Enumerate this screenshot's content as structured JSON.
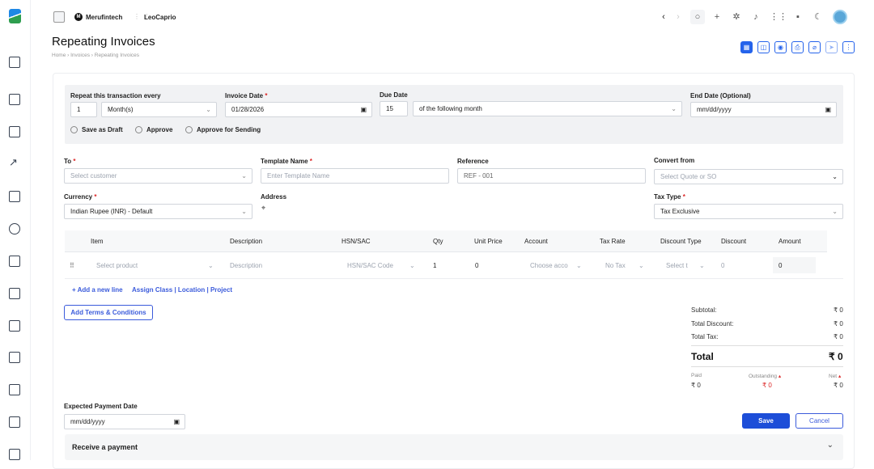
{
  "topbar": {
    "org": "Merufintech",
    "org_initial": "M",
    "user": "LeoCaprio"
  },
  "page": {
    "title": "Repeating Invoices",
    "breadcrumb": [
      "Home",
      "Invoices",
      "Repeating Invoices"
    ]
  },
  "repeat": {
    "label": "Repeat this transaction every",
    "count": "1",
    "unit": "Month(s)"
  },
  "invoice_date": {
    "label": "Invoice Date",
    "value": "01/28/2026"
  },
  "due_date": {
    "label": "Due Date",
    "days": "15",
    "term": "of the following month"
  },
  "end_date": {
    "label": "End Date (Optional)",
    "placeholder": "mm/dd/yyyy"
  },
  "status_options": [
    "Save as Draft",
    "Approve",
    "Approve for Sending"
  ],
  "to": {
    "label": "To",
    "placeholder": "Select customer"
  },
  "template": {
    "label": "Template Name",
    "placeholder": "Enter Template Name"
  },
  "reference": {
    "label": "Reference",
    "value": "REF - 001"
  },
  "convert": {
    "label": "Convert from",
    "placeholder": "Select Quote or SO"
  },
  "currency": {
    "label": "Currency",
    "value": "Indian Rupee (INR) - Default"
  },
  "address": {
    "label": "Address"
  },
  "tax_type": {
    "label": "Tax Type",
    "value": "Tax Exclusive"
  },
  "table": {
    "headers": [
      "Item",
      "Description",
      "HSN/SAC",
      "Qty",
      "Unit Price",
      "Account",
      "Tax Rate",
      "Discount Type",
      "Discount",
      "Amount"
    ],
    "row": {
      "item": "Select product",
      "description": "Description",
      "hsn": "HSN/SAC Code",
      "qty": "1",
      "unit_price": "0",
      "account": "Choose acco",
      "tax": "No Tax",
      "discount_type": "Select t",
      "discount": "0",
      "amount": "0"
    }
  },
  "links": {
    "add_line": "+ Add a new line",
    "assign": "Assign Class | Location | Project",
    "terms": "Add Terms & Conditions"
  },
  "summary": {
    "subtotal_label": "Subtotal:",
    "subtotal": "₹ 0",
    "discount_label": "Total Discount:",
    "discount": "₹ 0",
    "tax_label": "Total Tax:",
    "tax": "₹ 0",
    "total_label": "Total",
    "total": "₹ 0",
    "paid_label": "Paid",
    "paid": "₹ 0",
    "outstanding_label": "Outstanding",
    "outstanding": "₹ 0",
    "net_label": "Net",
    "net": "₹ 0"
  },
  "expected": {
    "label": "Expected Payment Date",
    "placeholder": "mm/dd/yyyy"
  },
  "actions": {
    "save": "Save",
    "cancel": "Cancel"
  },
  "receive": {
    "label": "Receive a payment"
  }
}
